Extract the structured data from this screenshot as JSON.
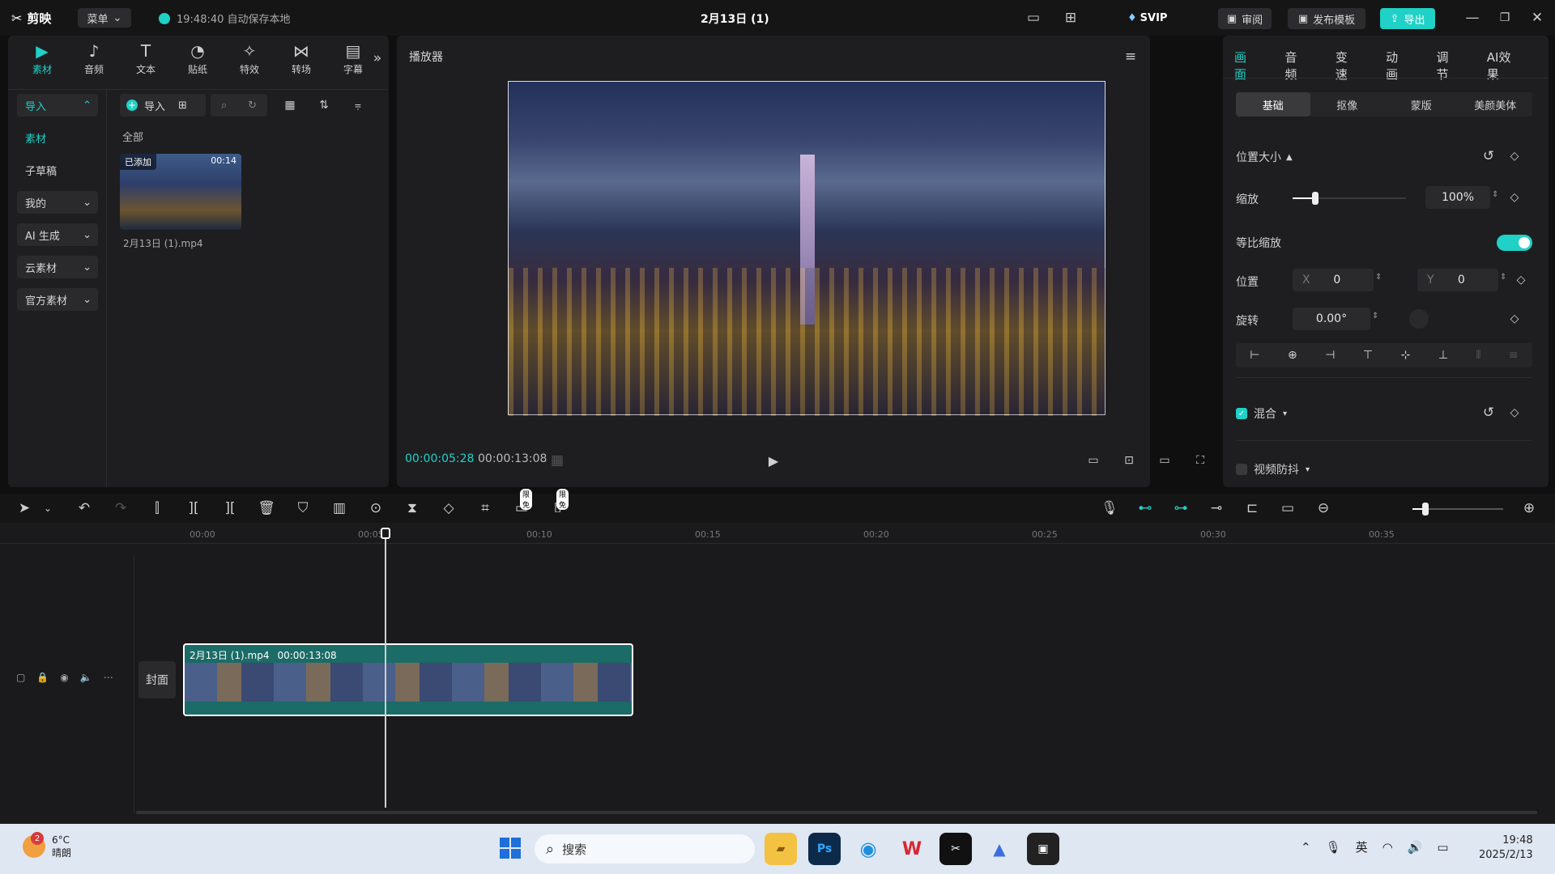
{
  "app": {
    "logo": "剪映",
    "menu": "菜单",
    "autosave": "19:48:40 自动保存本地",
    "project_title": "2月13日 (1)",
    "svip": "SVIP",
    "review": "审阅",
    "publish_template": "发布模板",
    "export": "导出"
  },
  "left_tabs": [
    {
      "label": "素材",
      "icon": "media-icon"
    },
    {
      "label": "音频",
      "icon": "audio-icon"
    },
    {
      "label": "文本",
      "icon": "text-icon"
    },
    {
      "label": "贴纸",
      "icon": "sticker-icon"
    },
    {
      "label": "特效",
      "icon": "effects-icon"
    },
    {
      "label": "转场",
      "icon": "transition-icon"
    },
    {
      "label": "字幕",
      "icon": "subtitle-icon"
    }
  ],
  "sidebar": [
    {
      "label": "导入",
      "arrow": "^"
    },
    {
      "label": "素材",
      "arrow": ""
    },
    {
      "label": "子草稿",
      "arrow": ""
    },
    {
      "label": "我的",
      "arrow": "v"
    },
    {
      "label": "AI 生成",
      "arrow": "v"
    },
    {
      "label": "云素材",
      "arrow": "v"
    },
    {
      "label": "官方素材",
      "arrow": "v"
    }
  ],
  "media": {
    "import_btn": "导入",
    "filter_all": "全部",
    "clip_badge": "已添加",
    "clip_duration": "00:14",
    "clip_name": "2月13日 (1).mp4"
  },
  "player": {
    "title": "播放器",
    "current_time": "00:00:05:28",
    "total_time": "00:00:13:08"
  },
  "right_tabs": [
    "画面",
    "音频",
    "变速",
    "动画",
    "调节",
    "AI效果"
  ],
  "sub_tabs": [
    "基础",
    "抠像",
    "蒙版",
    "美颜美体"
  ],
  "props": {
    "section_position": "位置大小",
    "scale_label": "缩放",
    "scale_value": "100%",
    "scale_level": 0.2,
    "uniform_scale_label": "等比缩放",
    "position_label": "位置",
    "x_label": "X",
    "x_value": "0",
    "y_label": "Y",
    "y_value": "0",
    "rotate_label": "旋转",
    "rotate_value": "0.00°",
    "blend_label": "混合",
    "stabilize_label": "视频防抖"
  },
  "toolbar": {
    "free_badge_1": "限免",
    "free_badge_2": "限免"
  },
  "timeline": {
    "ruler": [
      "00:00",
      "00:05",
      "00:10",
      "00:15",
      "00:20",
      "00:25",
      "00:30",
      "00:35"
    ],
    "cover_label": "封面",
    "clip_name": "2月13日 (1).mp4",
    "clip_duration": "00:00:13:08"
  },
  "taskbar": {
    "weather_badge": "2",
    "temp": "6°C",
    "weather": "晴朗",
    "search": "搜索",
    "ime": "英",
    "time": "19:48",
    "date": "2025/2/13"
  },
  "colors": {
    "accent": "#1fd1c6",
    "clip": "#1b6b66",
    "bg": "#1e1e20"
  }
}
